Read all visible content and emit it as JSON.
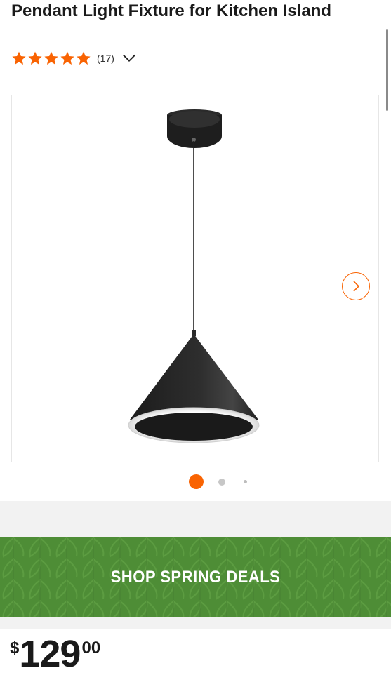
{
  "product": {
    "title": "Pendant Light Fixture for Kitchen Island",
    "rating": 5,
    "review_count": "(17)"
  },
  "gallery": {
    "image_alt": "Black cone pendant light with LED ring",
    "slide_count": 3,
    "active_slide": 1,
    "next_icon": "chevron-right-icon"
  },
  "banner": {
    "label": "SHOP SPRING DEALS",
    "color": "#4e8d36"
  },
  "price": {
    "currency": "$",
    "dollars": "129",
    "cents": "00"
  },
  "colors": {
    "accent": "#f96302",
    "title": "#1a1a1a"
  }
}
